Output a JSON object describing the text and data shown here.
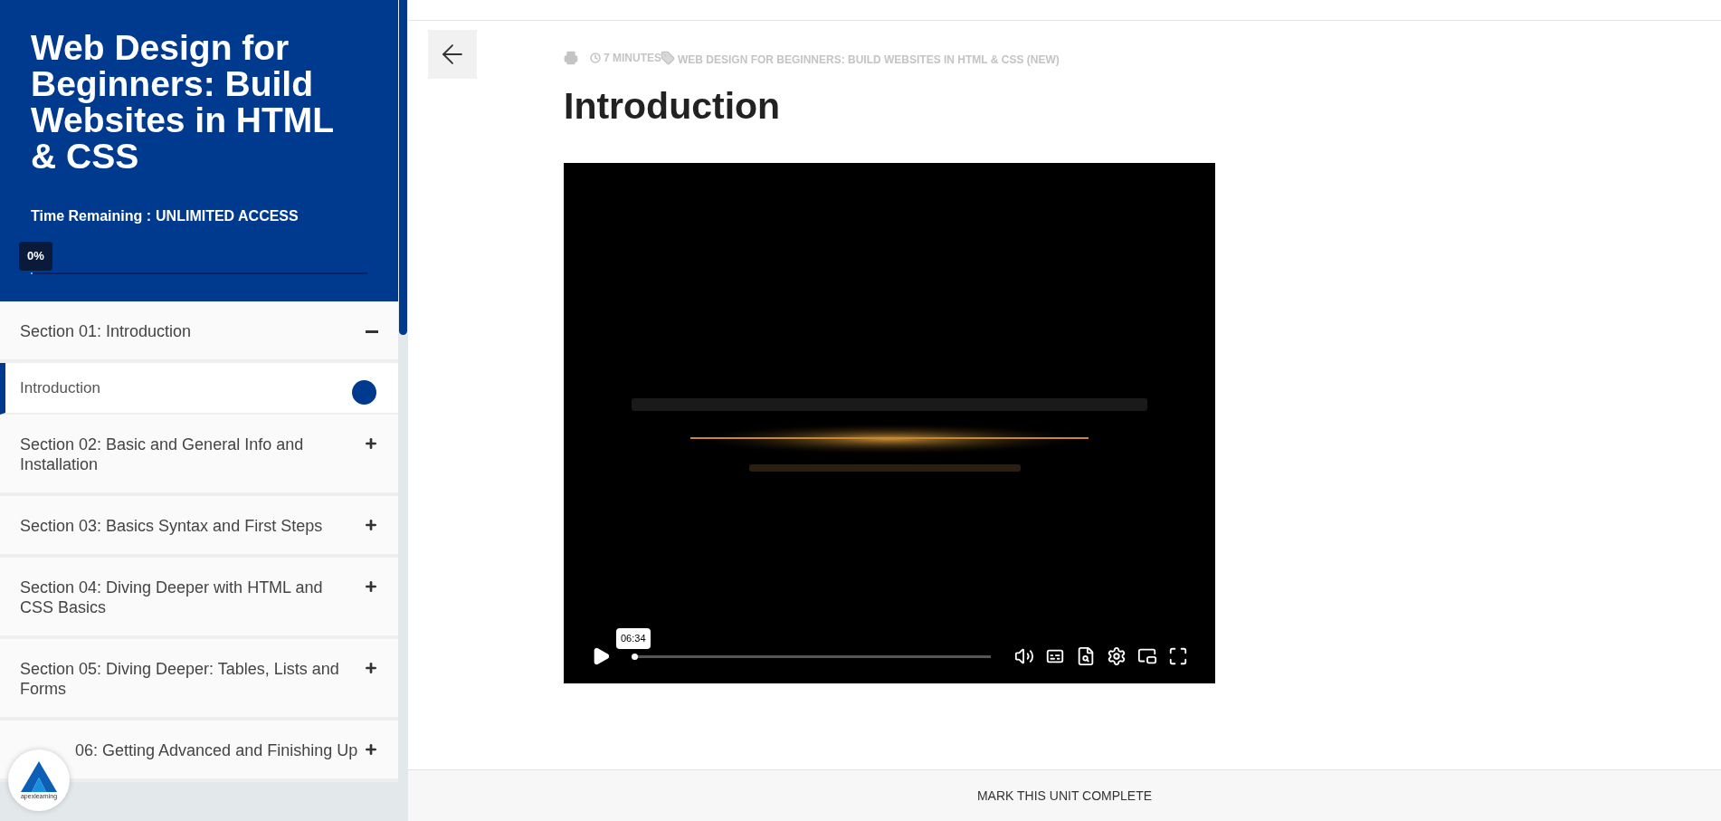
{
  "course": {
    "title": "Web Design for Beginners: Build Websites in HTML & CSS",
    "time_remaining_label": "Time Remaining :",
    "time_remaining_value": "UNLIMITED ACCESS",
    "progress": {
      "label": "0%",
      "level": 0
    }
  },
  "sections": [
    {
      "title": "Section 01: Introduction",
      "expanded": true,
      "covered": false,
      "units": [
        {
          "title": "Introduction",
          "selected": true
        }
      ]
    },
    {
      "title": "Section 02: Basic and General Info and Installation",
      "expanded": false,
      "covered": false
    },
    {
      "title": "Section 03: Basics Syntax and First Steps",
      "expanded": false,
      "covered": false
    },
    {
      "title": "Section 04: Diving Deeper with HTML and CSS Basics",
      "expanded": false,
      "covered": false
    },
    {
      "title": "Section 05: Diving Deeper: Tables, Lists and Forms",
      "expanded": false,
      "covered": false
    },
    {
      "title": "06: Getting Advanced and Finishing Up",
      "expanded": false,
      "covered": true
    }
  ],
  "logo": {
    "text": "apexlearning"
  },
  "unit": {
    "duration": "7 MINUTES",
    "course_tag": "WEB DESIGN FOR BEGINNERS: BUILD WEBSITES IN HTML & CSS (NEW)",
    "title": "Introduction",
    "video": {
      "kind": "picture",
      "time_tooltip": "06:34",
      "level": 0
    }
  },
  "footer": {
    "button": "MARK THIS UNIT COMPLETE"
  }
}
